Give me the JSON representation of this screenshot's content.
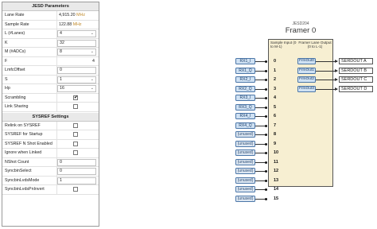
{
  "panel": {
    "jesd_title": "JESD Parameters",
    "sysref_title": "SYSREF Settings",
    "jesd_rows": [
      {
        "label": "Lane Rate",
        "value": "4,915.20",
        "unit": "MHz",
        "kind": "plain"
      },
      {
        "label": "Sample Rate",
        "value": "122.88",
        "unit": "MHz",
        "kind": "plain"
      },
      {
        "label": "L (#Lanes)",
        "value": "4",
        "kind": "select"
      },
      {
        "label": "K",
        "value": "32",
        "kind": "input"
      },
      {
        "label": "M (#ADCs)",
        "value": "8",
        "kind": "select"
      },
      {
        "label": "F",
        "value": "4",
        "kind": "num"
      },
      {
        "label": "LmfcOffset",
        "value": "0",
        "kind": "input"
      },
      {
        "label": "S",
        "value": "1",
        "kind": "select"
      },
      {
        "label": "Hp",
        "value": "16",
        "kind": "select"
      },
      {
        "label": "Scrambling",
        "checked": true,
        "kind": "check"
      },
      {
        "label": "Link Sharing",
        "checked": false,
        "kind": "check"
      }
    ],
    "sysref_rows": [
      {
        "label": "Relink on SYSREF",
        "checked": false,
        "kind": "check"
      },
      {
        "label": "SYSREF for Startup",
        "checked": false,
        "kind": "check"
      },
      {
        "label": "SYSREF N Shot Enabled",
        "checked": false,
        "kind": "check"
      },
      {
        "label": "Ignore when Linked",
        "checked": false,
        "kind": "check"
      },
      {
        "label": "NShot Count",
        "value": "0",
        "kind": "input"
      },
      {
        "label": "SyncbinSelect",
        "value": "0",
        "kind": "input"
      },
      {
        "label": "SyncbinLvdsMode",
        "value": "1",
        "kind": "input"
      },
      {
        "label": "SyncbinLvdsPnInvert",
        "checked": false,
        "kind": "check"
      }
    ],
    "check_glyph": "✔",
    "chevron": "⌄"
  },
  "framer": {
    "subtitle": "JESD204",
    "title": "Framer 0",
    "input_header": "Sample Input (0 to M-1)",
    "output_header": "Framer Lane Output (0 to L-1)",
    "inputs": [
      "RX1_I",
      "RX1_Q",
      "RX2_I",
      "RX2_Q",
      "RX3_I",
      "RX3_Q",
      "RX4_I",
      "RX4_Q",
      "(unused)",
      "(unused)",
      "(unused)",
      "(unused)",
      "(unused)",
      "(unused)",
      "(unused)",
      "(unused)"
    ],
    "pins": [
      "0",
      "1",
      "2",
      "3",
      "4",
      "5",
      "6",
      "7",
      "8",
      "9",
      "10",
      "11",
      "12",
      "13",
      "14",
      "15"
    ],
    "outputs": [
      "FrmOut0",
      "FrmOut1",
      "FrmOut2",
      "FrmOut3"
    ],
    "serdes": [
      "SERDOUT A",
      "SERDOUT B",
      "SERDOUT C",
      "SERDOUT D"
    ]
  },
  "colors": {
    "framer_fill": "#f7efd2",
    "port_fill": "#cfe1f3",
    "port_border": "#4b76a8",
    "unit_color": "#c08a2a"
  }
}
